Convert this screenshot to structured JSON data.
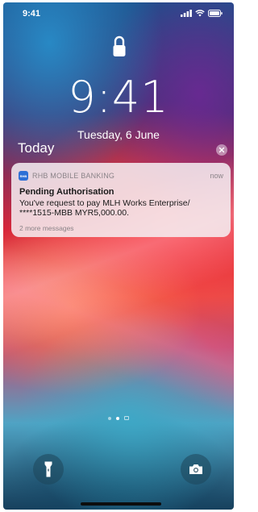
{
  "status_bar": {
    "time": "9:41",
    "signal_icon": "signal-bars-icon",
    "wifi_icon": "wifi-icon",
    "battery_icon": "battery-icon"
  },
  "lock_screen": {
    "lock_icon": "lock-icon",
    "time": "9:41",
    "date": "Tuesday, 6 June"
  },
  "notification_center": {
    "section_title": "Today",
    "clear_icon": "close-icon"
  },
  "notification": {
    "app_icon_text": "RHB",
    "app_name": "RHB MOBILE BANKING",
    "time": "now",
    "title": "Pending Authorisation",
    "body_line1": "You've request to pay MLH Works Enterprise/",
    "body_line2": "****1515-MBB MYR5,000.00.",
    "more": "2 more messages"
  },
  "bottom": {
    "flashlight_icon": "flashlight-icon",
    "camera_icon": "camera-icon"
  },
  "colors": {
    "accent_blue": "#2d6fd6",
    "notification_bg": "#f5f0f3"
  }
}
